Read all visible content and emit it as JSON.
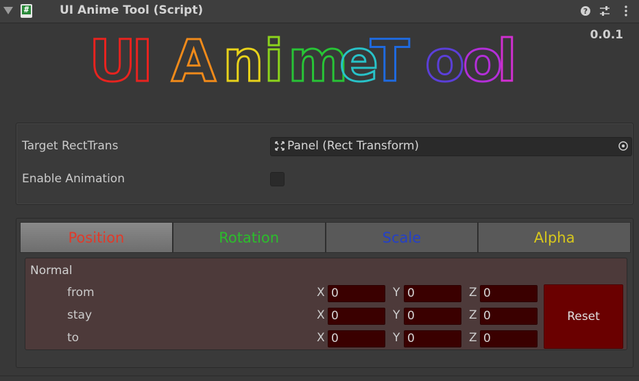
{
  "header": {
    "title": "UI Anime Tool (Script)",
    "icons": [
      "foldout-arrow-icon",
      "script-icon",
      "help-icon",
      "presets-icon",
      "kebab-menu-icon"
    ]
  },
  "version": "0.0.1",
  "logo": {
    "letters": [
      "U",
      "I",
      "A",
      "n",
      "i",
      "m",
      "e",
      "T",
      "o",
      "o",
      "l"
    ],
    "colors": [
      "#e8231f",
      "#e8231f",
      "#f08a1a",
      "#e8d21a",
      "#8cd41c",
      "#28c436",
      "#28c2c8",
      "#1f6adf",
      "#5b3fd8",
      "#b32fd8",
      "#d02fd0"
    ]
  },
  "fields": {
    "target_label": "Target RectTrans",
    "target_value": "Panel (Rect Transform)",
    "enable_label": "Enable Animation",
    "enable_checked": false
  },
  "tabs": [
    {
      "label": "Position",
      "color": "#e03a2a",
      "active": true
    },
    {
      "label": "Rotation",
      "color": "#2cbd2c",
      "active": false
    },
    {
      "label": "Scale",
      "color": "#2440c8",
      "active": false
    },
    {
      "label": "Alpha",
      "color": "#d8c81c",
      "active": false
    }
  ],
  "section": {
    "title": "Normal",
    "axes": {
      "x": "X",
      "y": "Y",
      "z": "Z"
    },
    "rows": [
      {
        "label": "from",
        "x": "0",
        "y": "0",
        "z": "0"
      },
      {
        "label": "stay",
        "x": "0",
        "y": "0",
        "z": "0"
      },
      {
        "label": "to",
        "x": "0",
        "y": "0",
        "z": "0"
      }
    ],
    "reset_label": "Reset"
  }
}
